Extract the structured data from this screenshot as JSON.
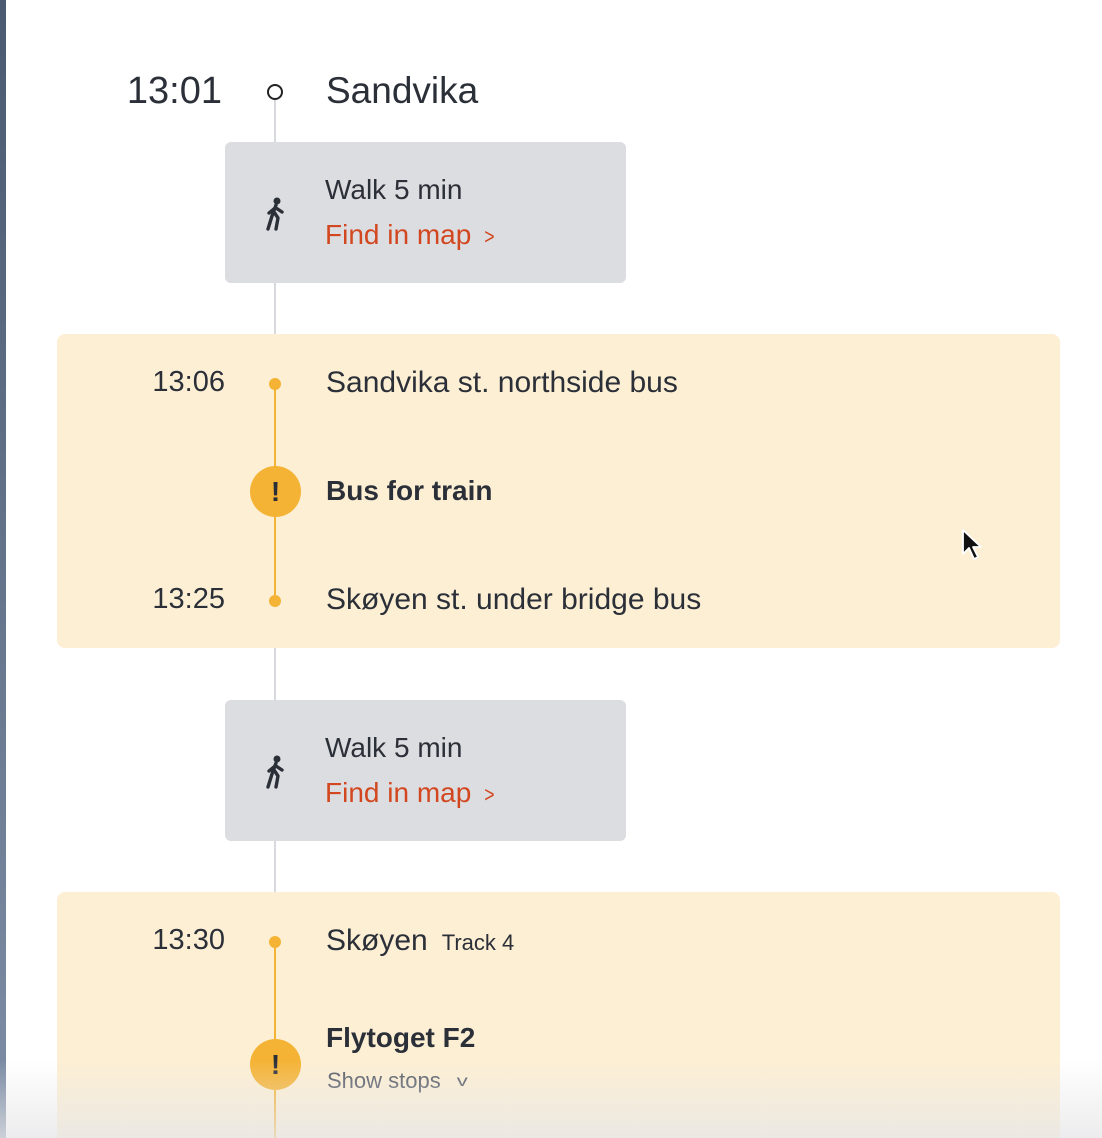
{
  "journey": {
    "start": {
      "time": "13:01",
      "name": "Sandvika"
    },
    "walk1": {
      "label": "Walk 5 min",
      "link": "Find in map",
      "link_chevron": ">"
    },
    "leg1": {
      "from_time": "13:06",
      "from_name": "Sandvika st. northside bus",
      "title": "Bus for train",
      "alert_symbol": "!",
      "to_time": "13:25",
      "to_name": "Skøyen st. under bridge bus"
    },
    "walk2": {
      "label": "Walk 5 min",
      "link": "Find in map",
      "link_chevron": ">"
    },
    "leg2": {
      "from_time": "13:30",
      "from_name": "Skøyen",
      "track": "Track 4",
      "title": "Flytoget F2",
      "alert_symbol": "!",
      "show_stops": "Show stops",
      "show_stops_chevron": "v"
    }
  },
  "colors": {
    "accent_orange": "#f5b335",
    "leg_background": "#fdefd4",
    "walk_background": "#dcdde0",
    "link_red": "#d2471f"
  },
  "icons": [
    "walk-icon",
    "alert-icon",
    "chevron-right-icon",
    "chevron-down-icon",
    "mouse-cursor-icon"
  ]
}
